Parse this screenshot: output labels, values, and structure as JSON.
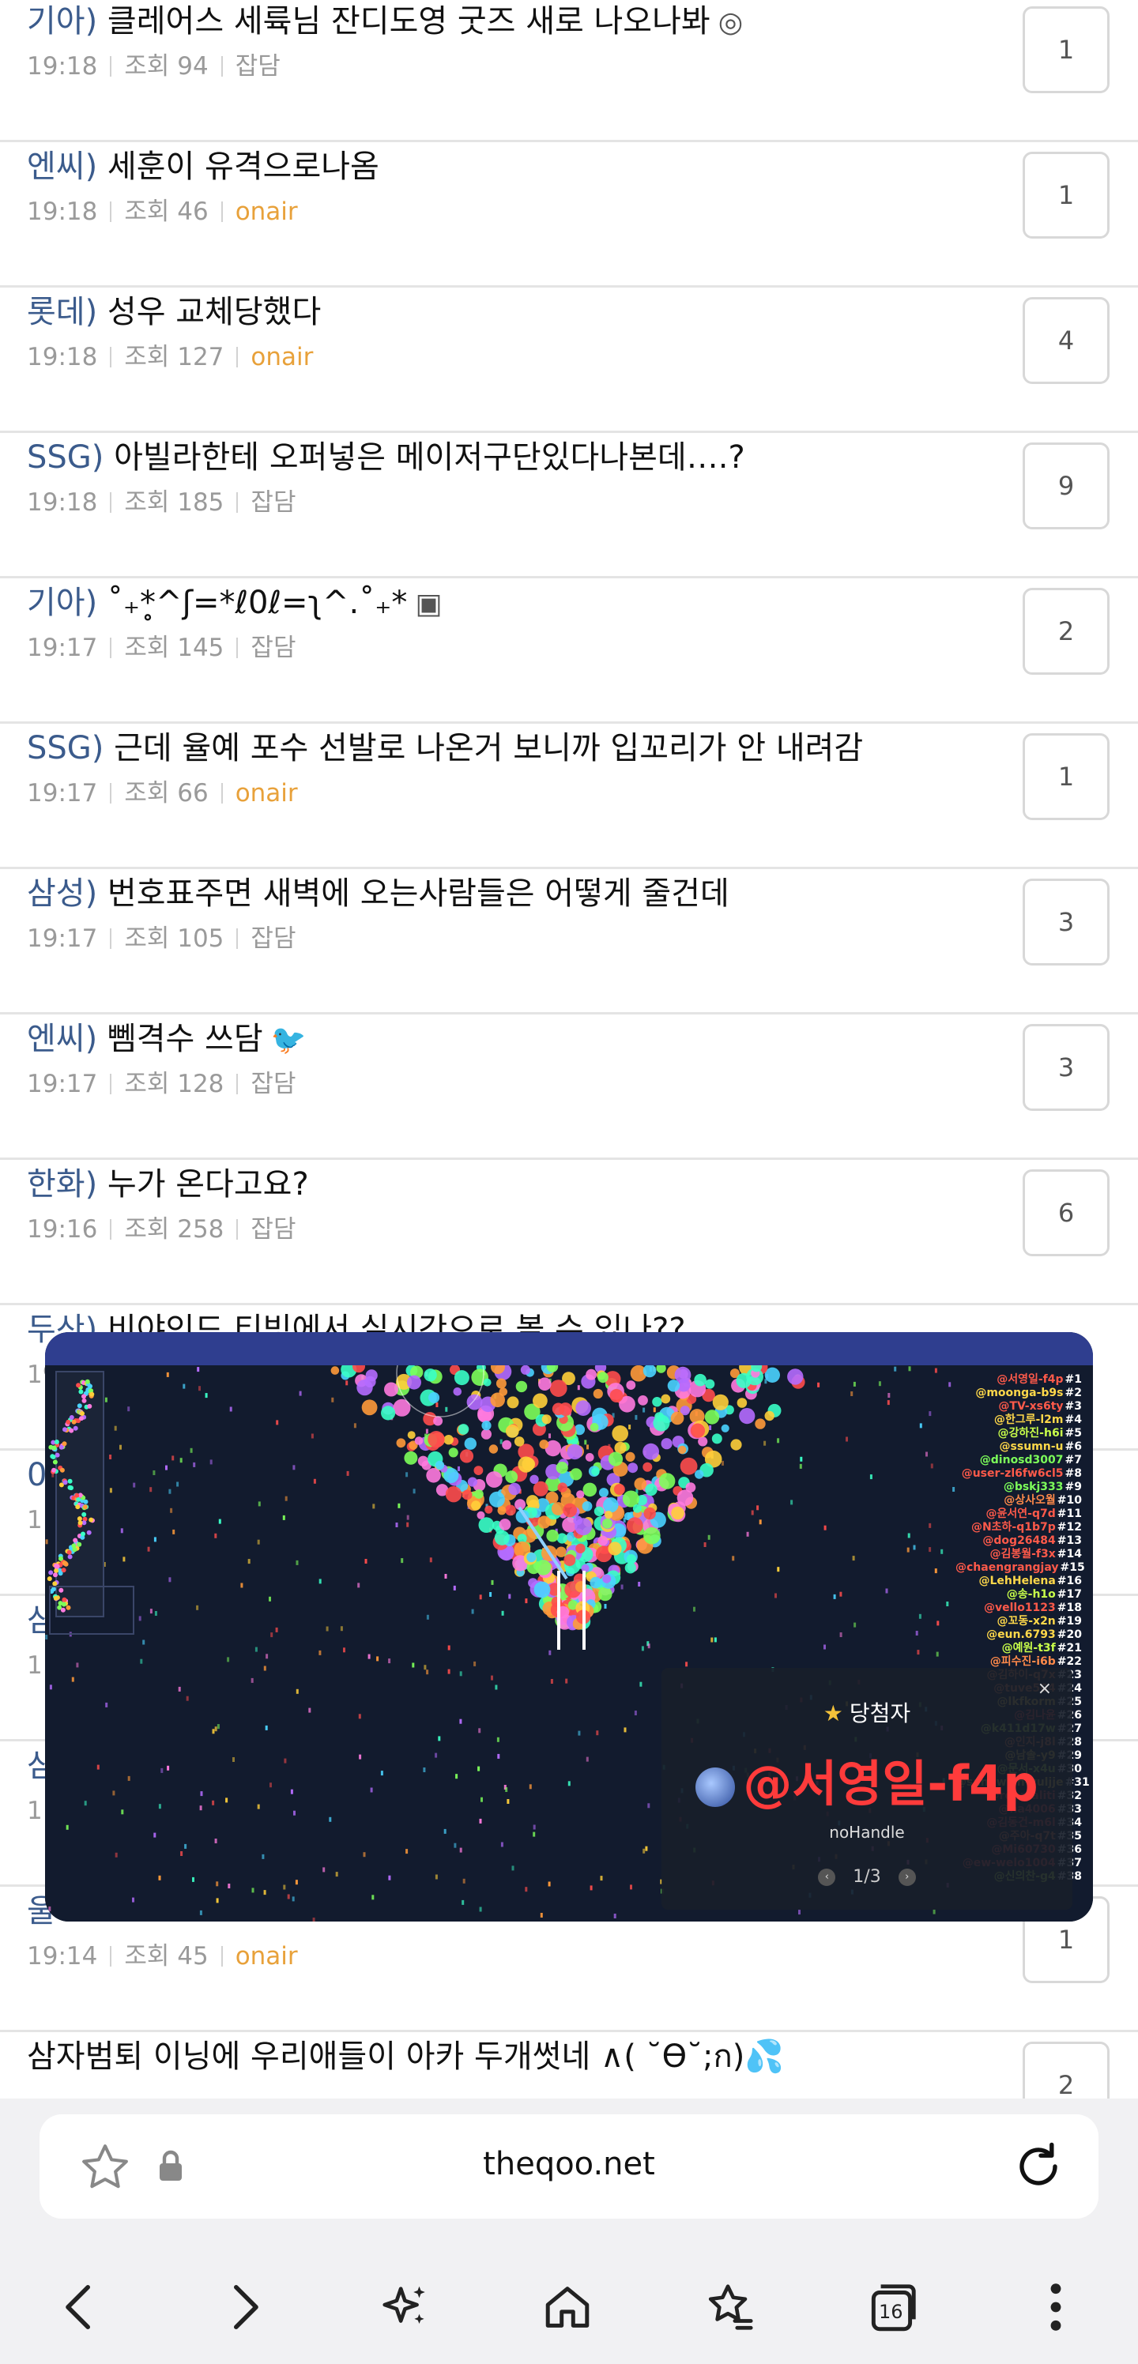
{
  "posts": [
    {
      "category": "기아)",
      "title": " 클레어스 세륙님 잔디도영 굿즈 새로 나오나봐",
      "icon": "instagram-icon",
      "time": "19:18",
      "views": "조회 94",
      "board": "잡담",
      "onair": false,
      "comments": "1"
    },
    {
      "category": "엔씨)",
      "title": " 세훈이 유격으로나옴",
      "icon": "",
      "time": "19:18",
      "views": "조회 46",
      "board": "onair",
      "onair": true,
      "comments": "1"
    },
    {
      "category": "롯데)",
      "title": " 성우 교체당했다",
      "icon": "",
      "time": "19:18",
      "views": "조회 127",
      "board": "onair",
      "onair": true,
      "comments": "4"
    },
    {
      "category": "SSG)",
      "title": " 아빌라한테 오퍼넣은 메이저구단있다나본데….?",
      "icon": "",
      "time": "19:18",
      "views": "조회 185",
      "board": "잡담",
      "onair": false,
      "comments": "9"
    },
    {
      "category": "기아)",
      "title": " ˚₊*̥^ʃ=*ℓ0ℓ=ʅ^.˚₊*",
      "icon": "image-icon",
      "time": "19:17",
      "views": "조회 145",
      "board": "잡담",
      "onair": false,
      "comments": "2"
    },
    {
      "category": "SSG)",
      "title": " 근데 율예 포수 선발로 나온거 보니까 입꼬리가 안 내려감",
      "icon": "",
      "time": "19:17",
      "views": "조회 66",
      "board": "onair",
      "onair": true,
      "comments": "1"
    },
    {
      "category": "삼성)",
      "title": " 번호표주면 새벽에 오는사람들은 어떻게 줄건데",
      "icon": "",
      "time": "19:17",
      "views": "조회 105",
      "board": "잡담",
      "onair": false,
      "comments": "3"
    },
    {
      "category": "엔씨)",
      "title": " 뻼격수 쓰담",
      "icon": "twitter-icon",
      "time": "19:17",
      "views": "조회 128",
      "board": "잡담",
      "onair": false,
      "comments": "3"
    },
    {
      "category": "한화)",
      "title": " 누가 온다고요?",
      "icon": "",
      "time": "19:16",
      "views": "조회 258",
      "board": "잡담",
      "onair": false,
      "comments": "6"
    },
    {
      "category": "두산)",
      "title": " 비야인드 티빙에서 실시간으로 볼 수 있나??",
      "icon": "",
      "time": "19",
      "views": "",
      "board": "",
      "onair": false,
      "comments": ""
    },
    {
      "category": "0",
      "title": "",
      "icon": "",
      "time": "1",
      "views": "",
      "board": "",
      "onair": false,
      "comments": ""
    },
    {
      "category": "삼",
      "title": "",
      "icon": "",
      "time": "1",
      "views": "",
      "board": "",
      "onair": false,
      "comments": ""
    },
    {
      "category": "삼",
      "title": "",
      "icon": "",
      "time": "1",
      "views": "",
      "board": "",
      "onair": false,
      "comments": ""
    },
    {
      "category": "울",
      "title": "",
      "icon": "",
      "time": "19:14",
      "views": "조회 45",
      "board": "onair",
      "onair": true,
      "comments": "1"
    },
    {
      "category": "",
      "title": "삼자범퇴 이닝에 우리애들이 아카 두개썻네 ∧( ˘ϴ˘;ก)💦",
      "icon": "",
      "time": "",
      "views": "",
      "board": "",
      "onair": false,
      "comments": "2"
    }
  ],
  "overlay": {
    "winner_label": "당첨자",
    "winner_name": "@서영일-f4p",
    "winner_handle": "noHandle",
    "pager": "1/3",
    "close": "×",
    "ranking": [
      {
        "name": "@서영일-f4p",
        "n": "#1",
        "color": "#ff5a4a"
      },
      {
        "name": "@moonga-b9s",
        "n": "#2",
        "color": "#ffd84a"
      },
      {
        "name": "@TV-xs6ty",
        "n": "#3",
        "color": "#ff5a4a"
      },
      {
        "name": "@한그루-l2m",
        "n": "#4",
        "color": "#ffd84a"
      },
      {
        "name": "@강하진-h6i",
        "n": "#5",
        "color": "#c9ff4a"
      },
      {
        "name": "@ssumn-u",
        "n": "#6",
        "color": "#ffd84a"
      },
      {
        "name": "@dinosd3007",
        "n": "#7",
        "color": "#7dff5a"
      },
      {
        "name": "@user-zl6fw6cl5",
        "n": "#8",
        "color": "#ff5a4a"
      },
      {
        "name": "@bskj333",
        "n": "#9",
        "color": "#7dff5a"
      },
      {
        "name": "@상사오월",
        "n": "#10",
        "color": "#ff8a4a"
      },
      {
        "name": "@윤서연-q7d",
        "n": "#11",
        "color": "#ff5a4a"
      },
      {
        "name": "@N초하-q1b7p",
        "n": "#12",
        "color": "#ff5a4a"
      },
      {
        "name": "@dog26484",
        "n": "#13",
        "color": "#ff5a4a"
      },
      {
        "name": "@김봉월-f3x",
        "n": "#14",
        "color": "#ff5a4a"
      },
      {
        "name": "@chaengrangjay",
        "n": "#15",
        "color": "#ff5a4a"
      },
      {
        "name": "@LehHelena",
        "n": "#16",
        "color": "#ffd84a"
      },
      {
        "name": "@송-h1o",
        "n": "#17",
        "color": "#c9ff4a"
      },
      {
        "name": "@vello1123",
        "n": "#18",
        "color": "#ff5a4a"
      },
      {
        "name": "@꼬동-x2n",
        "n": "#19",
        "color": "#ffd84a"
      },
      {
        "name": "@eun.6793",
        "n": "#20",
        "color": "#ffd84a"
      },
      {
        "name": "@예원-t3f",
        "n": "#21",
        "color": "#c9ff4a"
      },
      {
        "name": "@피수진-i6b",
        "n": "#22",
        "color": "#ff8a4a"
      },
      {
        "name": "@김하이-q7x",
        "n": "#23",
        "color": "#ff8a4a"
      },
      {
        "name": "@tuve504",
        "n": "#24",
        "color": "#ff8a4a"
      },
      {
        "name": "@lkfkorm",
        "n": "#25",
        "color": "#ffd84a"
      },
      {
        "name": "@김나윤",
        "n": "#26",
        "color": "#ff5a4a"
      },
      {
        "name": "@k411d17w",
        "n": "#27",
        "color": "#c9ff4a"
      },
      {
        "name": "@인지-j8l",
        "n": "#28",
        "color": "#ff8a4a"
      },
      {
        "name": "@남솔-y9",
        "n": "#29",
        "color": "#ffd84a"
      },
      {
        "name": "@문서-x4u",
        "n": "#30",
        "color": "#c9ff4a"
      },
      {
        "name": "@sandwich-yuljje",
        "n": "#31",
        "color": "#ffd84a"
      },
      {
        "name": "@roomaliti",
        "n": "#32",
        "color": "#ff5a4a"
      },
      {
        "name": "@na4006",
        "n": "#33",
        "color": "#ff5a4a"
      },
      {
        "name": "@김동건-m6l",
        "n": "#34",
        "color": "#ff5a4a"
      },
      {
        "name": "@주아-q7t",
        "n": "#35",
        "color": "#ff8a4a"
      },
      {
        "name": "@Mi60730",
        "n": "#36",
        "color": "#ff5a4a"
      },
      {
        "name": "@ew-welo1004",
        "n": "#37",
        "color": "#ff5a4a"
      },
      {
        "name": "@신의찬-g4",
        "n": "#38",
        "color": "#c9ff4a"
      }
    ]
  },
  "browser": {
    "url": "theqoo.net",
    "tab_count": "16"
  }
}
